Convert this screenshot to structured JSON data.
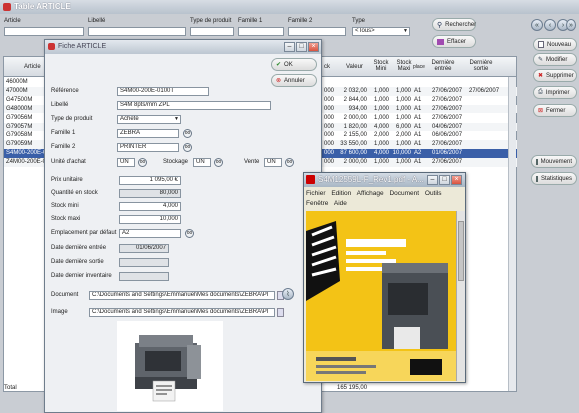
{
  "main": {
    "title": "Table ARTICLE",
    "filters": {
      "article_label": "Article",
      "libelle_label": "Libellé",
      "type_label": "Type de produit",
      "famille1_label": "Famille 1",
      "famille2_label": "Famille 2",
      "type2_label": "Type",
      "type2_value": "<Tous>"
    },
    "buttons": {
      "rechercher": "Rechercher",
      "effacer": "Effacer",
      "nouveau": "Nouveau",
      "modifier": "Modifier",
      "supprimer": "Supprimer",
      "imprimer": "Imprimer",
      "fermer": "Fermer",
      "mouvement": "Mouvement",
      "statistiques": "Statistiques"
    },
    "columns": {
      "article": "Article",
      "valeur": "Valeur",
      "stock_mini": "Stock Mini",
      "stock_maxi": "Stock Maxi",
      "place": "place",
      "derniere_entree": "Dernière entrée",
      "derniere_sortie": "Dernière sortie"
    },
    "rows": [
      {
        "article": "46000M",
        "qte": "",
        "valeur": "",
        "mini": "",
        "maxi": "",
        "place": "",
        "entree": "",
        "sortie": ""
      },
      {
        "article": "47000M",
        "qte": "000",
        "valeur": "2 032,00",
        "mini": "1,000",
        "maxi": "1,000",
        "place": "A1",
        "entree": "27/06/2007",
        "sortie": "27/06/2007"
      },
      {
        "article": "G47500M",
        "qte": "000",
        "valeur": "2 844,00",
        "mini": "1,000",
        "maxi": "1,000",
        "place": "A1",
        "entree": "27/06/2007",
        "sortie": ""
      },
      {
        "article": "G48000M",
        "qte": "000",
        "valeur": "934,00",
        "mini": "1,000",
        "maxi": "1,000",
        "place": "A1",
        "entree": "27/06/2007",
        "sortie": ""
      },
      {
        "article": "G79056M",
        "qte": "000",
        "valeur": "2 000,00",
        "mini": "1,000",
        "maxi": "1,000",
        "place": "A1",
        "entree": "27/06/2007",
        "sortie": ""
      },
      {
        "article": "G79057M",
        "qte": "000",
        "valeur": "1 820,00",
        "mini": "4,000",
        "maxi": "6,000",
        "place": "A1",
        "entree": "04/06/2007",
        "sortie": ""
      },
      {
        "article": "G79058M",
        "qte": "000",
        "valeur": "2 155,00",
        "mini": "2,000",
        "maxi": "2,000",
        "place": "A1",
        "entree": "06/06/2007",
        "sortie": ""
      },
      {
        "article": "G79059M",
        "qte": "000",
        "valeur": "33 550,00",
        "mini": "1,000",
        "maxi": "1,000",
        "place": "A1",
        "entree": "27/06/2007",
        "sortie": ""
      },
      {
        "article": "S4M00-200E-0",
        "qte": "000",
        "valeur": "87 600,00",
        "mini": "4,000",
        "maxi": "10,000",
        "place": "A2",
        "entree": "01/06/2007",
        "sortie": ""
      },
      {
        "article": "Z4M00-200E-0",
        "qte": "000",
        "valeur": "2 000,00",
        "mini": "1,000",
        "maxi": "1,000",
        "place": "A1",
        "entree": "27/06/2007",
        "sortie": ""
      }
    ],
    "total_label": "Total",
    "total_value": "165 195,00"
  },
  "fiche": {
    "title": "Fiche ARTICLE",
    "ok": "OK",
    "annuler": "Annuler",
    "reference_label": "Référence",
    "reference": "S4M00-200E-0100T",
    "libelle_label": "Libellé",
    "libelle": "S4M 8pts/mm ZPL",
    "type_label": "Type de produit",
    "type": "Acheté",
    "famille1_label": "Famille 1",
    "famille1": "ZEBRA",
    "famille2_label": "Famille 2",
    "famille2": "PRINTER",
    "unite_label": "Unité d'achat",
    "unite": "UN",
    "stockage_label": "Stockage",
    "stockage": "UN",
    "vente_label": "Vente",
    "vente": "UN",
    "prix_label": "Prix unitaire",
    "prix": "1 095,00 €",
    "qte_label": "Quantité en stock",
    "qte": "80,000",
    "mini_label": "Stock mini",
    "mini": "4,000",
    "maxi_label": "Stock maxi",
    "maxi": "10,000",
    "empl_label": "Emplacement par défaut",
    "empl": "A2",
    "entree_label": "Date dernière entrée",
    "entree": "01/06/2007",
    "sortie_label": "Date dernière sortie",
    "sortie": "",
    "inventaire_label": "Date dernier inventaire",
    "inventaire": "",
    "document_label": "Document",
    "document": "C:\\Documents and Settings\\Emmanuel\\Mes documents\\ZEBRA\\PI",
    "image_label": "Image",
    "image": "C:\\Documents and Settings\\Emmanuel\\Mes documents\\ZEBRA\\PI"
  },
  "pdf": {
    "title": "S4M12559L-F_Rev1.pdf - A...",
    "menu": [
      "Fichier",
      "Edition",
      "Affichage",
      "Document",
      "Outils",
      "Fenêtre",
      "Aide"
    ]
  },
  "colors": {
    "selected_row": "#3a5fa8",
    "pdf_yellow": "#f1c21b"
  }
}
